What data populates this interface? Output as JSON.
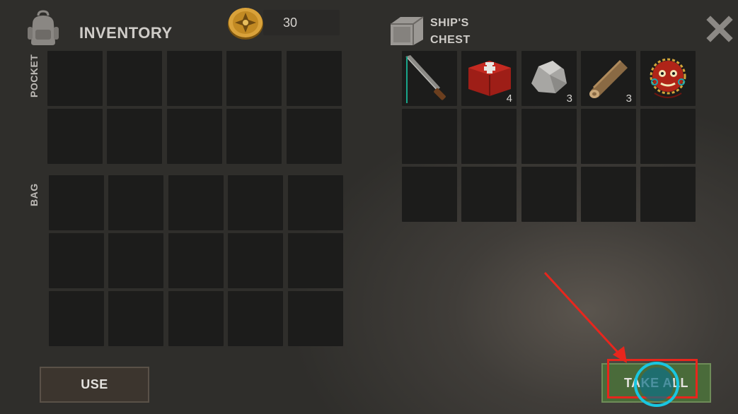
{
  "inventory": {
    "title": "INVENTORY",
    "pocket_label": "POCKET",
    "bag_label": "BAG",
    "icon": "backpack-icon"
  },
  "currency": {
    "icon": "gold-coin-icon",
    "amount": "30"
  },
  "chest": {
    "title_line1": "SHIP'S",
    "title_line2": "CHEST",
    "icon": "chest-icon",
    "items": [
      {
        "name": "machete",
        "icon": "machete-icon",
        "count": ""
      },
      {
        "name": "first-aid-kit",
        "icon": "first-aid-kit-icon",
        "count": "4"
      },
      {
        "name": "stone",
        "icon": "stone-icon",
        "count": "3"
      },
      {
        "name": "wood-log",
        "icon": "wood-log-icon",
        "count": "3"
      },
      {
        "name": "tribal-mask",
        "icon": "tribal-mask-icon",
        "count": ""
      }
    ]
  },
  "buttons": {
    "use_label": "USE",
    "take_all_label": "TAKE ALL",
    "close_icon": "close-icon"
  },
  "colors": {
    "slot_bg": "#1c1c1b",
    "take_all_bg": "#4a6b3a",
    "annotation_red": "#e8261d",
    "watermark_cyan": "#19c6e0"
  }
}
